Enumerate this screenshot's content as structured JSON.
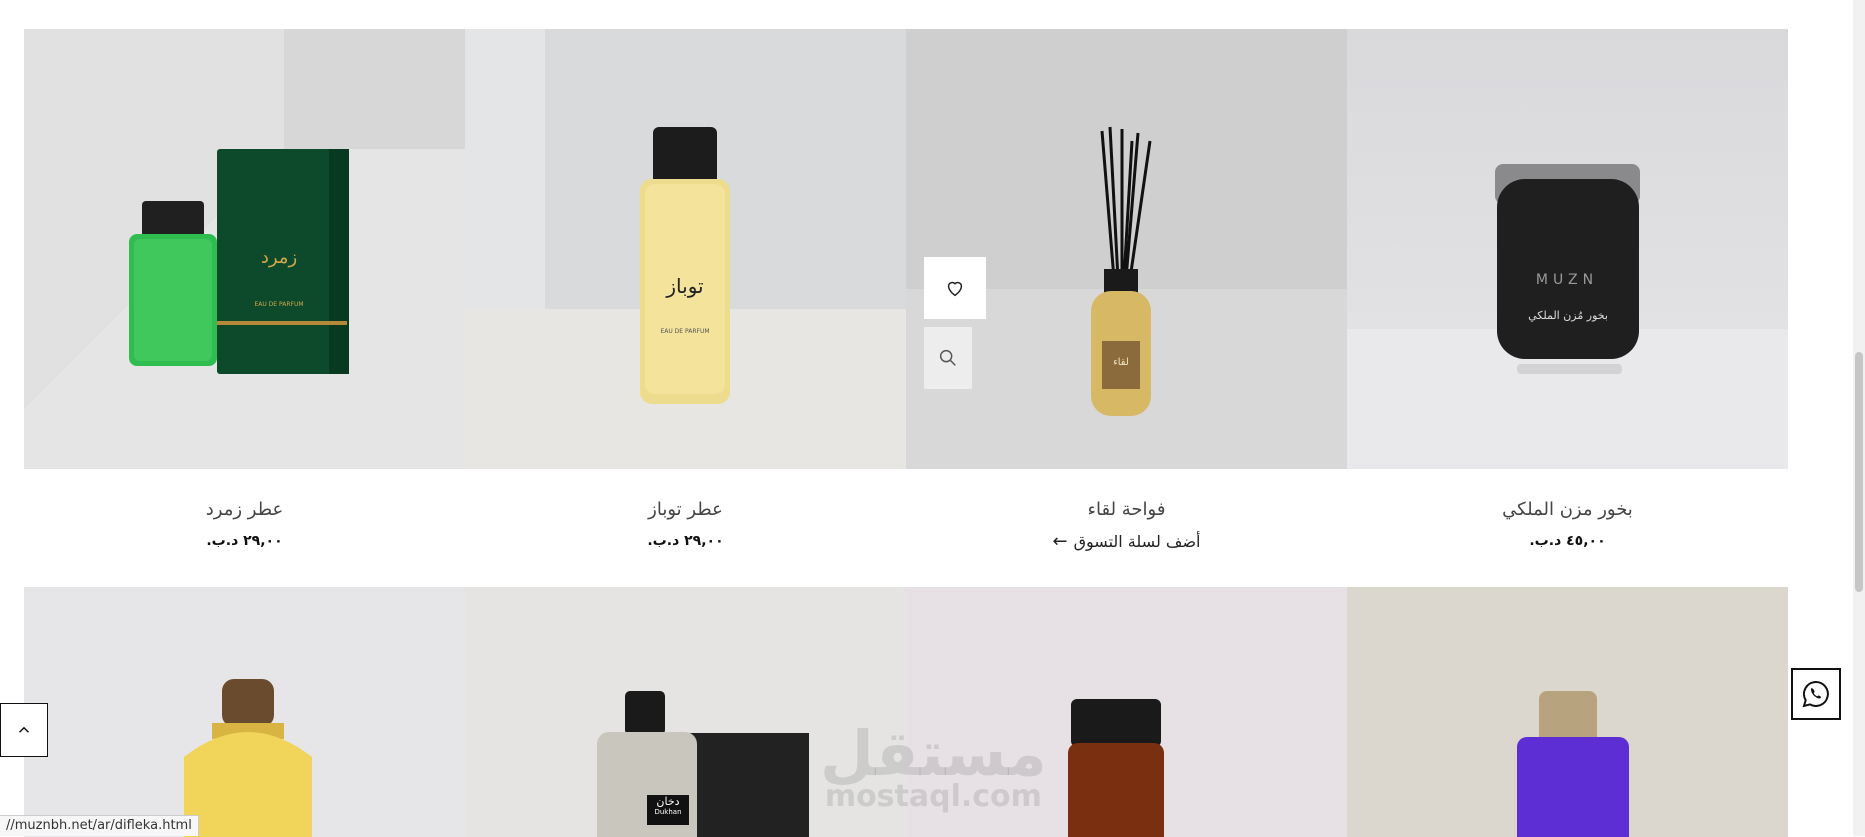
{
  "products_row1": [
    {
      "name": "بخور مزن الملكي",
      "price": "٤٥,٠٠ د.ب.",
      "image_icon": "bakhoor-jar-image"
    },
    {
      "name": "فواحة لقاء",
      "price": "",
      "add_to_cart": "أضف لسلة التسوق",
      "image_icon": "reed-diffuser-image"
    },
    {
      "name": "عطر توباز",
      "price": "٢٩,٠٠ د.ب.",
      "image_icon": "topaz-perfume-image"
    },
    {
      "name": "عطر زمرد",
      "price": "٢٩,٠٠ د.ب.",
      "image_icon": "emerald-perfume-image"
    }
  ],
  "product_labels": {
    "muzn_jar_brand": "MUZN",
    "muzn_jar_label": "بخور مُزن الملكي",
    "diffuser_label": "لقاء",
    "topaz_bottle": "توباز",
    "topaz_small": "EAU DE PARFUM",
    "zumurd_box": "زمرد",
    "zumurd_small": "EAU DE PARFUM",
    "dukhan_label": "دخان",
    "dukhan_small": "Dukhan"
  },
  "products_row2_images": [
    "violet-perfume-image",
    "amber-perfume-image",
    "dukhan-perfume-image",
    "yellow-perfume-image"
  ],
  "status_url": "//muznbh.net/ar/difleka.html",
  "watermark": {
    "arabic": "مستقل",
    "latin": "mostaql.com"
  },
  "colors": {
    "accent": "#111111",
    "whatsapp": "#111111"
  }
}
